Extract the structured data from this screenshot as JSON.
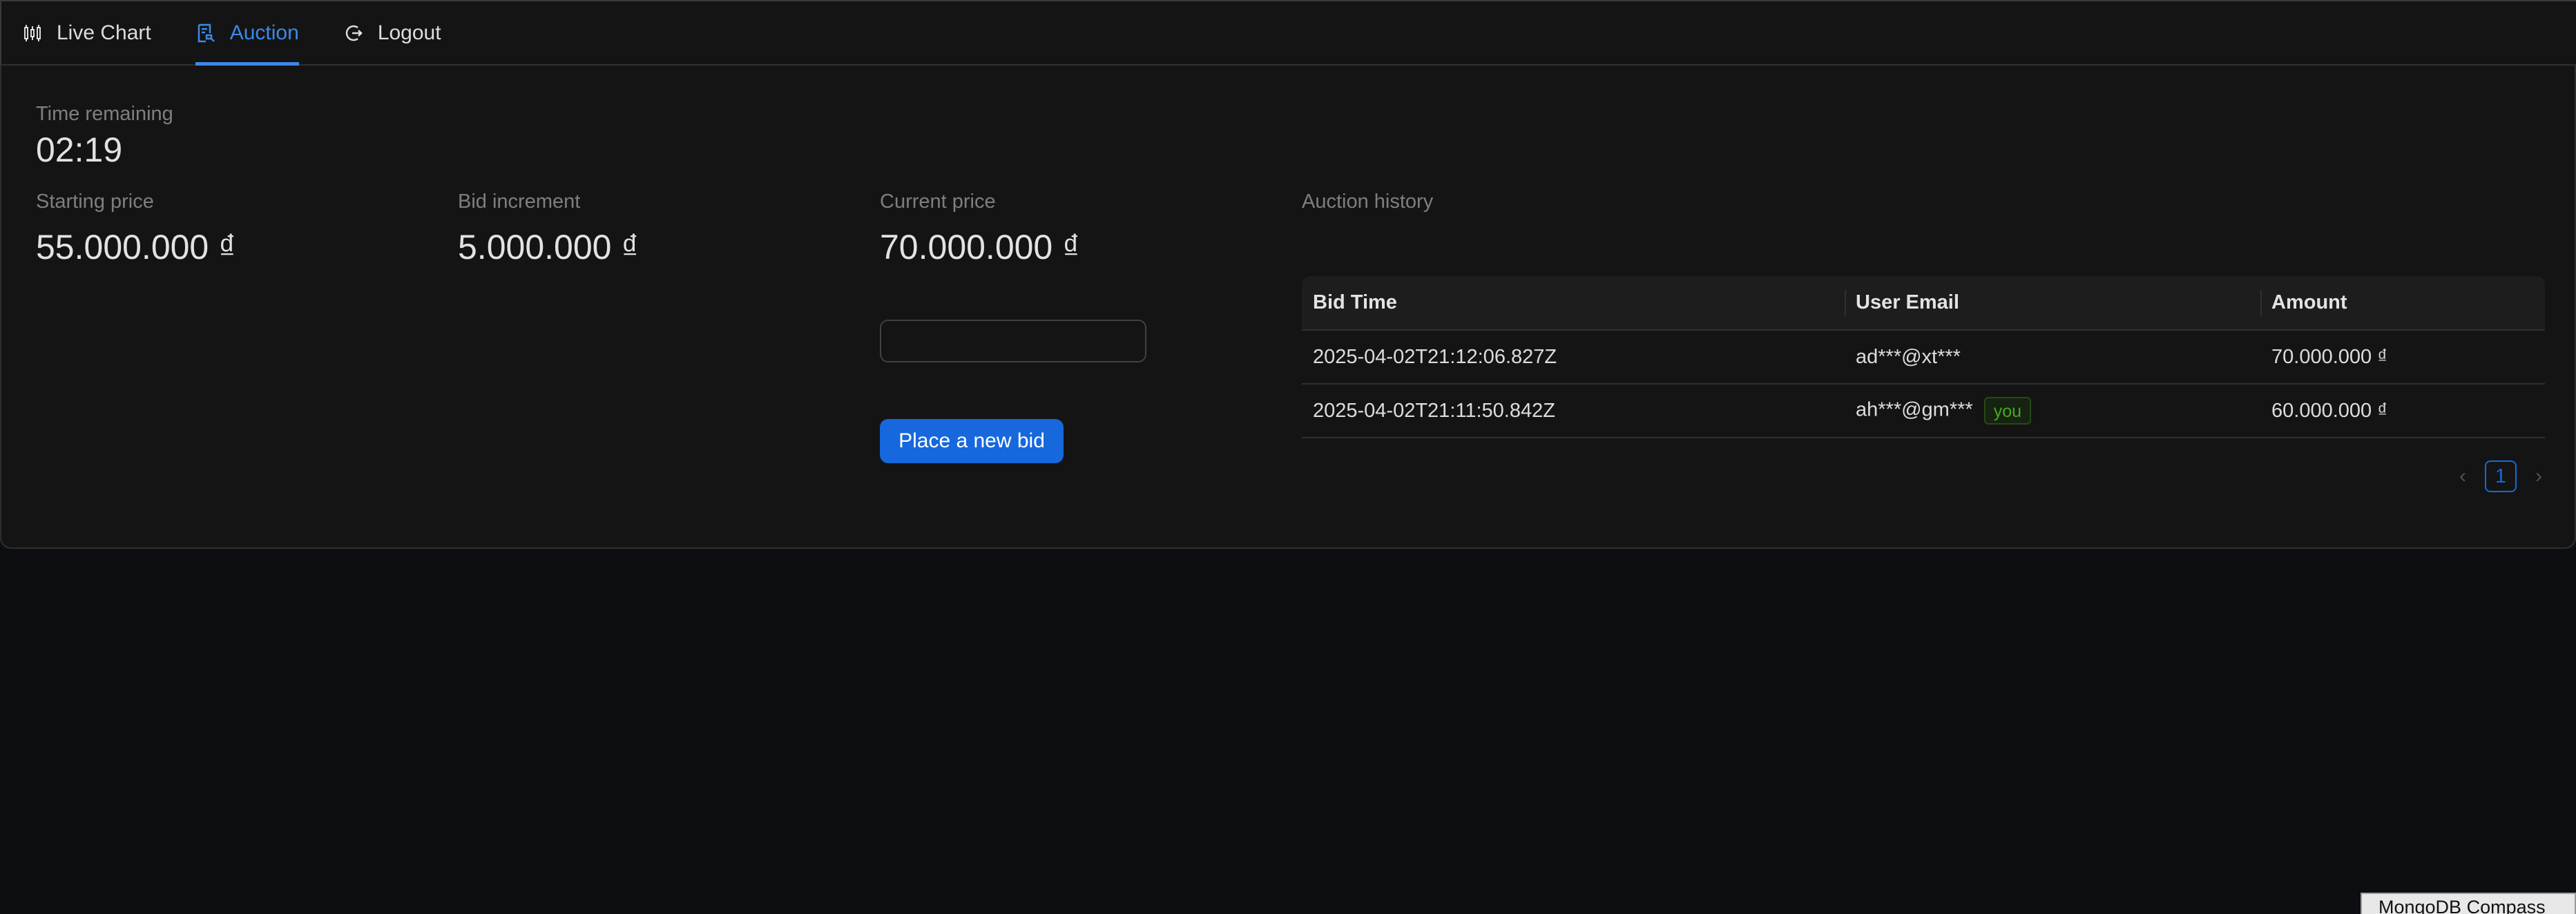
{
  "nav": {
    "items": [
      {
        "label": "Live Chart",
        "icon": "live-chart-icon",
        "active": false
      },
      {
        "label": "Auction",
        "icon": "auction-icon",
        "active": true
      },
      {
        "label": "Logout",
        "icon": "logout-icon",
        "active": false
      }
    ]
  },
  "auction": {
    "time_remaining_label": "Time remaining",
    "time_remaining_value": "02:19",
    "starting_price_label": "Starting price",
    "starting_price_value": "55.000.000 ₫",
    "bid_increment_label": "Bid increment",
    "bid_increment_value": "5.000.000 ₫",
    "current_price_label": "Current price",
    "current_price_value": "70.000.000 ₫",
    "bid_input_value": "",
    "bid_input_placeholder": "",
    "currency_addon": "₫",
    "place_bid_label": "Place a new bid"
  },
  "history": {
    "title": "Auction history",
    "columns": [
      "Bid Time",
      "User Email",
      "Amount"
    ],
    "rows": [
      {
        "time": "2025-04-02T21:12:06.827Z",
        "email": "ad***@xt***",
        "is_you": false,
        "amount": "70.000.000 ₫"
      },
      {
        "time": "2025-04-02T21:11:50.842Z",
        "email": "ah***@gm***",
        "is_you": true,
        "you_tag": "you",
        "amount": "60.000.000 ₫"
      }
    ],
    "pagination": {
      "current_page": "1",
      "prev": "‹",
      "next": "›"
    }
  },
  "taskbar": {
    "tooltip": "MongoDB Compass"
  },
  "colors": {
    "accent": "#1668dc",
    "nav_active": "#3c89e8",
    "background": "#0d0e11",
    "card": "#141414",
    "you_tag": "#49aa19"
  }
}
